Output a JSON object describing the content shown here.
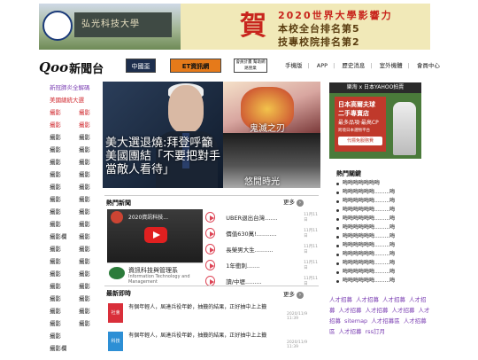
{
  "banner": {
    "he_char": "賀",
    "line1": "2020世界大學影響力",
    "line2": "本校全台排名第5",
    "line3": "技專校院排名第2",
    "building_text": "弘光科技大學"
  },
  "header": {
    "logo_mark": "Qoo",
    "logo_text": "新聞台",
    "badges": [
      "中國盃",
      "ET資訊網",
      "會員計畫 幫助網路營業"
    ],
    "nav": [
      "手機版",
      "APP",
      "歷史消息",
      "室外機體",
      "會員中心"
    ]
  },
  "sidebar": {
    "links": [
      {
        "text": "新冠肺炎全解碼",
        "color": "purple"
      },
      {
        "text": "美國總統大選",
        "color": "red"
      }
    ],
    "rows": [
      [
        "攝影",
        "攝影",
        "red"
      ],
      [
        "攝影",
        "攝影",
        "red"
      ],
      [
        "攝影",
        "攝影",
        "dark"
      ],
      [
        "攝影",
        "攝影",
        "dark"
      ],
      [
        "攝影",
        "攝影",
        "dark"
      ],
      [
        "攝影",
        "攝影",
        "dark"
      ],
      [
        "攝影",
        "攝影",
        "dark"
      ],
      [
        "攝影",
        "攝影",
        "dark"
      ],
      [
        "攝影",
        "攝影",
        "dark"
      ],
      [
        "攝影",
        "攝影",
        "dark"
      ],
      [
        "攝影欄",
        "攝影",
        "dark"
      ],
      [
        "攝影",
        "攝影",
        "dark"
      ],
      [
        "攝影",
        "攝影",
        "dark"
      ],
      [
        "攝影",
        "攝影",
        "dark"
      ],
      [
        "攝影",
        "攝影",
        "dark"
      ],
      [
        "攝影",
        "攝影",
        "dark"
      ],
      [
        "攝影",
        "攝影",
        "dark"
      ],
      [
        "攝影",
        "攝影",
        "dark"
      ],
      [
        "攝影",
        "",
        "dark"
      ],
      [
        "攝影欄",
        "",
        "dark"
      ]
    ]
  },
  "hero": {
    "caption": "美大選退燒:拜登呼籲美國團結「不要把對手當敵人看待」"
  },
  "tiles": {
    "anime_caption": "鬼滅之刃",
    "night_caption": "悠閒時光"
  },
  "hot_news": {
    "title": "熱門新聞",
    "more": "更多",
    "video_title": "2020資訊科技...",
    "org_name": "資訊科技與管理系",
    "org_en": "Information Technology and Management",
    "items": [
      {
        "text": "UBER退出台灣.......",
        "date": "11月11日"
      },
      {
        "text": "價值630萬!...........",
        "date": "11月11日"
      },
      {
        "text": "長榮男大生..........",
        "date": "11月11日"
      },
      {
        "text": "1年衝刺.......",
        "date": "11月11日"
      },
      {
        "text": "讀/中壢.........",
        "date": "11月11日"
      }
    ]
  },
  "latest": {
    "title": "最新即時",
    "more": "更多",
    "items": [
      {
        "thumb": "社會",
        "text": "有個年輕人，屆達兵役年齡，抽籤的結果，正好抽中上上籤",
        "date": "2020/11/9 11:39",
        "color": "#d92f3a"
      },
      {
        "thumb": "科技",
        "text": "有個年輕人，屆達兵役年齡，抽籤的結果，正好抽中上上籤",
        "date": "2020/11/9 11:39",
        "color": "#2d8fd5"
      }
    ]
  },
  "ad": {
    "top": "樂淘 x 日本YAHOO拍賣",
    "line1": "日本高爾夫球",
    "line2": "二手專賣店",
    "line3": "最多品項‧最高CP",
    "line4": "跨境日本選物平台",
    "cta": "代標免服務費"
  },
  "hot_list": {
    "title": "熱門關鍵",
    "items": [
      "晦晦晦晦晦晦晦",
      "晦晦晦晦晦晦.........晦",
      "晦晦晦晦晦晦.........晦",
      "晦晦晦晦晦晦.........晦",
      "晦晦晦晦晦晦.........晦",
      "晦晦晦晦晦晦.........晦",
      "晦晦晦晦晦晦.........晦",
      "晦晦晦晦晦晦.........晦",
      "晦晦晦晦晦晦.........晦",
      "晦晦晦晦晦晦.........晦",
      "晦晦晦晦晦晦.........晦",
      "晦晦晦晦晦晦.........晦"
    ]
  },
  "tags": [
    "人才招募",
    "人才招募",
    "人才招募",
    "人才招募",
    "人才招募",
    "人才招募",
    "人才招募",
    "人才招募",
    "sitemap",
    "人才招募區",
    "人才招募區",
    "人才招募",
    "rss訂月"
  ],
  "colors": {
    "red": "#d0282e",
    "purple": "#7b3fb3",
    "dark": "#222"
  }
}
